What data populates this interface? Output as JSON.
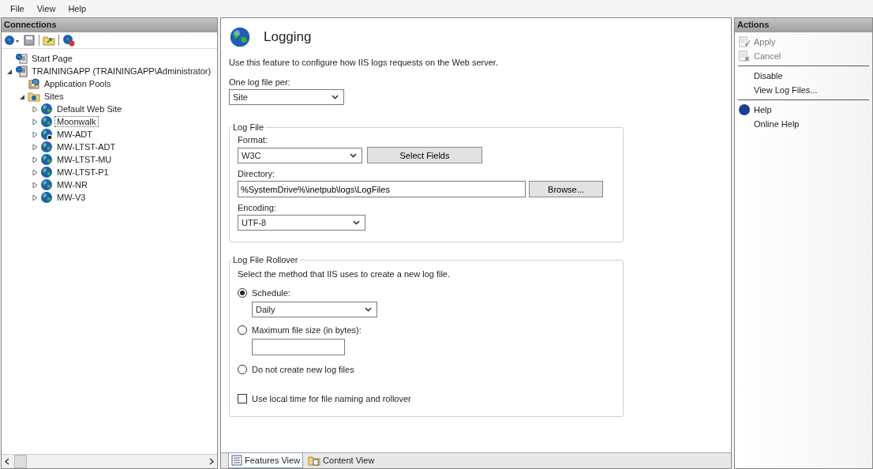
{
  "menu": [
    "File",
    "View",
    "Help"
  ],
  "connections": {
    "title": "Connections",
    "tree": [
      {
        "label": "Start Page",
        "kind": "start-page",
        "selected": false
      },
      {
        "label": "TRAININGAPP (TRAININGAPP\\Administrator)",
        "kind": "server",
        "expanded": true,
        "selected": false,
        "children": [
          {
            "label": "Application Pools",
            "kind": "app-pools",
            "selected": false
          },
          {
            "label": "Sites",
            "kind": "sites",
            "expanded": true,
            "selected": false,
            "children": [
              {
                "label": "Default Web Site",
                "kind": "site",
                "expanded": false,
                "stopped": false,
                "selected": false
              },
              {
                "label": "Moonwalk",
                "kind": "site",
                "expanded": false,
                "stopped": false,
                "selected": true
              },
              {
                "label": "MW-ADT",
                "kind": "site",
                "expanded": false,
                "stopped": true,
                "selected": false
              },
              {
                "label": "MW-LTST-ADT",
                "kind": "site",
                "expanded": false,
                "stopped": false,
                "selected": false
              },
              {
                "label": "MW-LTST-MU",
                "kind": "site",
                "expanded": false,
                "stopped": false,
                "selected": false
              },
              {
                "label": "MW-LTST-P1",
                "kind": "site",
                "expanded": false,
                "stopped": false,
                "selected": false
              },
              {
                "label": "MW-NR",
                "kind": "site",
                "expanded": false,
                "stopped": false,
                "selected": false
              },
              {
                "label": "MW-V3",
                "kind": "site",
                "expanded": false,
                "stopped": false,
                "selected": false
              }
            ]
          }
        ]
      }
    ]
  },
  "feature": {
    "title": "Logging",
    "description": "Use this feature to configure how IIS logs requests on the Web server.",
    "log_file_per": {
      "label": "One log file per:",
      "value": "Site"
    },
    "log_file": {
      "title": "Log File",
      "format": {
        "label": "Format:",
        "value": "W3C"
      },
      "select_fields": "Select Fields",
      "directory": {
        "label": "Directory:",
        "value": "%SystemDrive%\\inetpub\\logs\\LogFiles"
      },
      "browse": "Browse...",
      "encoding": {
        "label": "Encoding:",
        "value": "UTF-8"
      }
    },
    "rollover": {
      "title": "Log File Rollover",
      "description": "Select the method that IIS uses to create a new log file.",
      "options": [
        {
          "label": "Schedule:",
          "selected": true,
          "kind": "select",
          "value": "Daily"
        },
        {
          "label": "Maximum file size (in bytes):",
          "selected": false,
          "kind": "input"
        },
        {
          "label": "Do not create new log files",
          "selected": false,
          "kind": "none"
        }
      ],
      "local_time": {
        "label": "Use local time for file naming and rollover",
        "checked": false
      }
    }
  },
  "view_tabs": [
    {
      "label": "Features View",
      "selected": true
    },
    {
      "label": "Content View",
      "selected": false
    }
  ],
  "actions": {
    "title": "Actions",
    "groups": [
      [
        {
          "label": "Apply",
          "kind": "apply",
          "disabled": true
        },
        {
          "label": "Cancel",
          "kind": "cancel",
          "disabled": true
        }
      ],
      [
        {
          "label": "Disable",
          "kind": "plain",
          "disabled": false
        },
        {
          "label": "View Log Files...",
          "kind": "plain",
          "disabled": false
        }
      ],
      [
        {
          "label": "Help",
          "kind": "help",
          "disabled": false
        },
        {
          "label": "Online Help",
          "kind": "plain",
          "disabled": false
        }
      ]
    ]
  }
}
